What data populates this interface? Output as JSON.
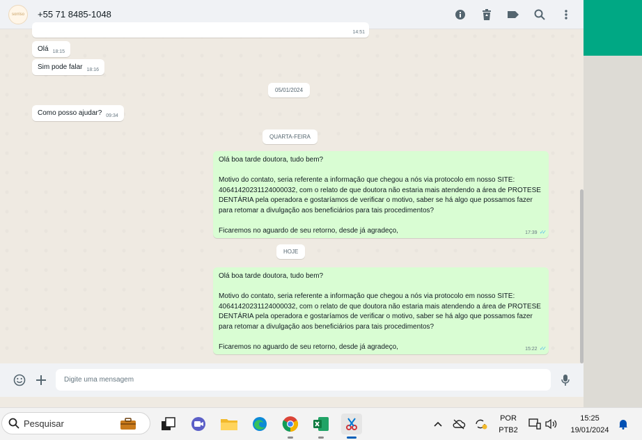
{
  "header": {
    "avatar_text": "sorriso",
    "contact_name": "+55 71 8485-1048"
  },
  "messages": {
    "m0_time": "14:51",
    "m1_text": "Olá",
    "m1_time": "18:15",
    "m2_text": "Sim pode falar",
    "m2_time": "18:16",
    "date1": "05/01/2024",
    "m3_text": "Como posso ajudar?",
    "m3_time": "09:34",
    "date2": "QUARTA-FEIRA",
    "m4_text": "Olá boa tarde doutora, tudo bem?\n\nMotivo do contato, seria referente a informação que chegou a nós via protocolo em nosso SITE: 40641420231124000032, com o relato de que doutora não estaria mais atendendo a área de PROTESE DENTÁRIA pela operadora e gostaríamos de verificar o motivo, saber se há algo que possamos fazer para retomar a divulgação aos beneficiários para tais procedimentos?\n\nFicaremos no aguardo de seu retorno, desde já agradeço,",
    "m4_time": "17:39",
    "date3": "HOJE",
    "m5_text": "Olá boa tarde doutora, tudo bem?\n\nMotivo do contato, seria referente a informação que chegou a nós via protocolo em nosso SITE: 40641420231124000032, com o relato de que doutora não estaria mais atendendo a área de PROTESE DENTÁRIA pela operadora e gostaríamos de verificar o motivo, saber se há algo que possamos fazer para retomar a divulgação aos beneficiários para tais procedimentos?\n\nFicaremos no aguardo de seu retorno, desde já agradeço,",
    "m5_time": "15:22"
  },
  "composer": {
    "placeholder": "Digite uma mensagem"
  },
  "taskbar": {
    "search_placeholder": "Pesquisar",
    "lang_top": "POR",
    "lang_bottom": "PTB2",
    "time": "15:25",
    "date": "19/01/2024"
  },
  "icons": {
    "info": "info-icon",
    "delete": "trash-icon",
    "label": "label-icon",
    "search": "search-icon",
    "menu": "kebab-menu-icon",
    "emoji": "emoji-icon",
    "attach": "plus-icon",
    "mic": "microphone-icon"
  },
  "colors": {
    "accent": "#00a884",
    "outgoing_bubble": "#d9fdd3",
    "chat_bg": "#efeae2",
    "read_ticks": "#53bdeb"
  }
}
